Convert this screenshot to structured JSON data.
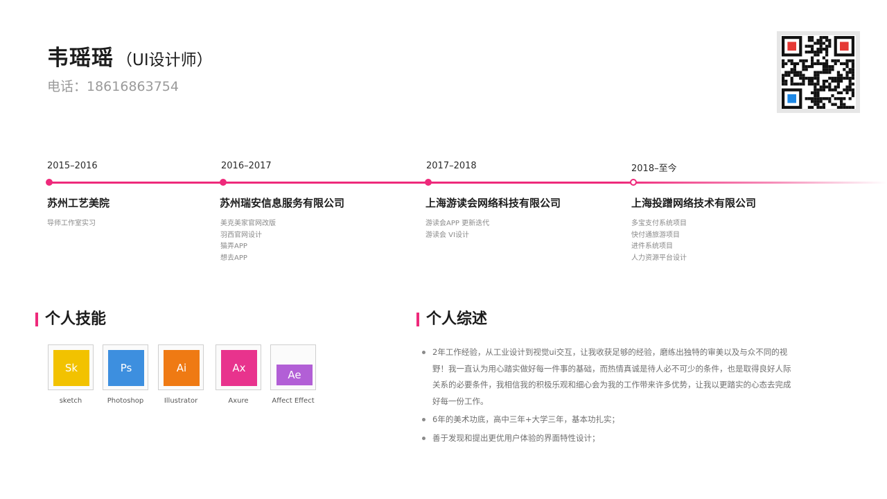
{
  "header": {
    "name": "韦瑶瑶",
    "role": "（UI设计师）",
    "phone": "电话：18616863754"
  },
  "qr": {
    "icon": "qr-code-icon",
    "finder_colors": [
      "#e53935",
      "#e53935",
      "#1e88e5"
    ]
  },
  "timeline": {
    "line_color": "#ee2a7b",
    "items": [
      {
        "period": "2015–2016",
        "org": "苏州工艺美院",
        "details": [
          "导师工作室实习"
        ]
      },
      {
        "period": "2016–2017",
        "org": "苏州瑞安信息服务有限公司",
        "details": [
          "美克美家官网改版",
          "羽西官网设计",
          "猫弄APP",
          "想去APP"
        ]
      },
      {
        "period": "2017–2018",
        "org": "上海游读会网络科技有限公司",
        "details": [
          "游读会APP 更新迭代",
          "游读会 VI设计"
        ]
      },
      {
        "period": "2018–至今",
        "org": "上海投蹭网络技术有限公司",
        "details": [
          "多宝支付系统项目",
          "快付通旅游项目",
          "进件系统项目",
          "人力资源平台设计"
        ]
      }
    ]
  },
  "skills": {
    "title": "个人技能",
    "items": [
      {
        "abbr": "Sk",
        "label": "sketch",
        "color": "#f2c200"
      },
      {
        "abbr": "Ps",
        "label": "Photoshop",
        "color": "#3d8fdf"
      },
      {
        "abbr": "Ai",
        "label": "Illustrator",
        "color": "#ef7a13"
      },
      {
        "abbr": "Ax",
        "label": "Axure",
        "color": "#e8338d"
      },
      {
        "abbr": "Ae",
        "label": "Affect Effect",
        "color": "#b25fd6"
      }
    ]
  },
  "summary": {
    "title": "个人综述",
    "points": [
      "2年工作经验，从工业设计到视觉ui交互，让我收获足够的经验，磨练出独特的审美以及与众不同的视野！我一直认为用心踏实做好每一件事的基础，而热情真诚是待人必不可少的条件，也是取得良好人际关系的必要条件，我相信我的积极乐观和细心会为我的工作带来许多优势，让我以更踏实的心态去完成好每一份工作。",
      "6年的美术功底，高中三年+大学三年，基本功扎实；",
      "善于发现和提出更优用户体验的界面特性设计；"
    ]
  },
  "accent_color": "#ee2a7b"
}
